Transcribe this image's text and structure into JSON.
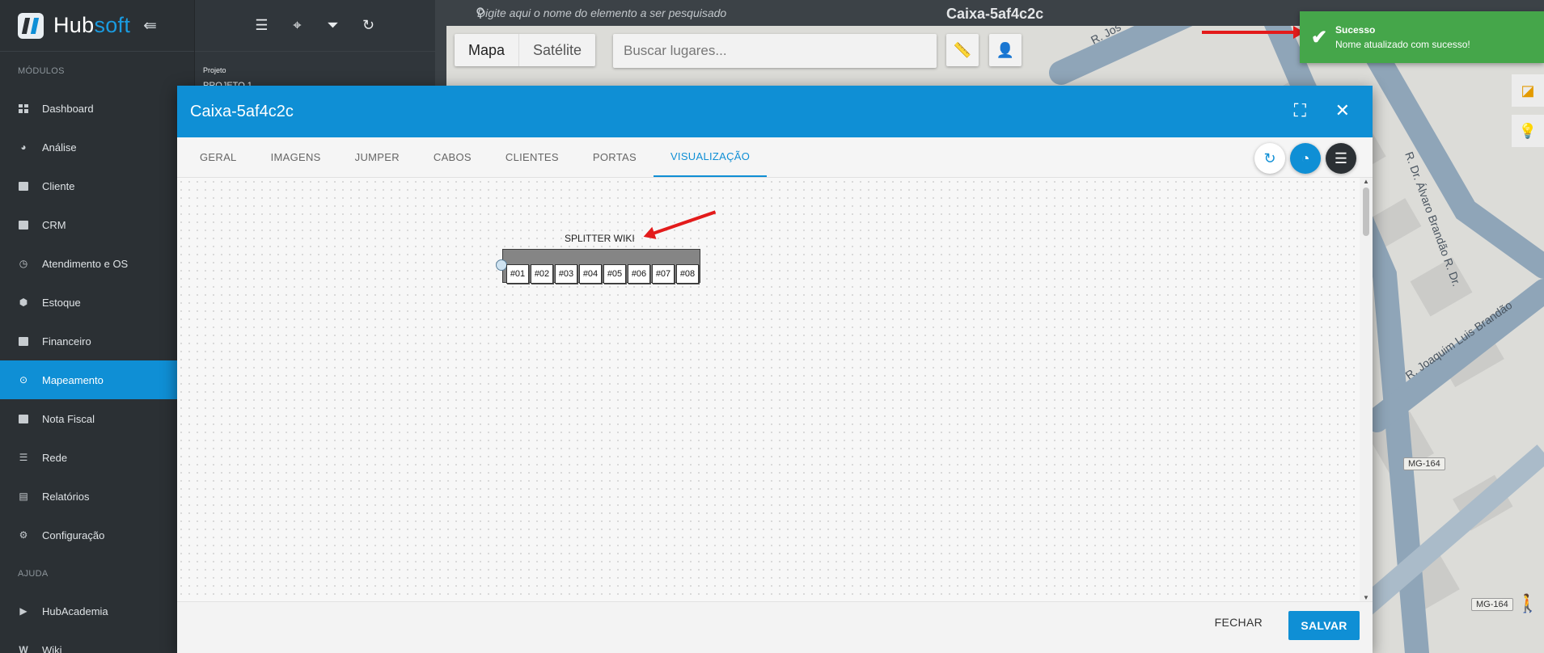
{
  "brand": {
    "name_part1": "Hub",
    "name_part2": "soft"
  },
  "sidebar": {
    "section_modules": "MÓDULOS",
    "items": [
      {
        "label": "Dashboard",
        "icon": "dashboard-icon"
      },
      {
        "label": "Análise",
        "icon": "pie-chart-icon"
      },
      {
        "label": "Cliente",
        "icon": "contact-card-icon",
        "has_submenu": true
      },
      {
        "label": "CRM",
        "icon": "crm-icon"
      },
      {
        "label": "Atendimento e OS",
        "icon": "calendar-clock-icon"
      },
      {
        "label": "Estoque",
        "icon": "box-icon"
      },
      {
        "label": "Financeiro",
        "icon": "money-icon"
      },
      {
        "label": "Mapeamento",
        "icon": "map-pin-icon",
        "active": true
      },
      {
        "label": "Nota Fiscal",
        "icon": "invoice-icon"
      },
      {
        "label": "Rede",
        "icon": "server-icon"
      },
      {
        "label": "Relatórios",
        "icon": "report-icon"
      },
      {
        "label": "Configuração",
        "icon": "gear-icon",
        "has_submenu": true
      }
    ],
    "section_help": "AJUDA",
    "help_items": [
      {
        "label": "HubAcademia",
        "icon": "play-icon"
      },
      {
        "label": "Wiki",
        "icon": "wiki-icon"
      }
    ]
  },
  "tool_panel": {
    "project_label": "Projeto",
    "project_value": "PROJETO 1"
  },
  "map": {
    "search_placeholder": "Digite aqui o nome do elemento a ser pesquisado",
    "title": "Caixa-5af4c2c",
    "map_type_options": [
      "Mapa",
      "Satélite"
    ],
    "selected_map_type": "Mapa",
    "places_placeholder": "Buscar lugares...",
    "road_tag_1": "MG-164",
    "road_tag_2": "MG-164"
  },
  "toast": {
    "title": "Sucesso",
    "message": "Nome atualizado com sucesso!",
    "color": "#45a64a"
  },
  "modal": {
    "title": "Caixa-5af4c2c",
    "tabs": [
      "GERAL",
      "IMAGENS",
      "JUMPER",
      "CABOS",
      "CLIENTES",
      "PORTAS",
      "VISUALIZAÇÃO"
    ],
    "active_tab": "VISUALIZAÇÃO",
    "splitter": {
      "label": "SPLITTER WIKI",
      "ports": [
        "#01",
        "#02",
        "#03",
        "#04",
        "#05",
        "#06",
        "#07",
        "#08"
      ]
    },
    "footer": {
      "close_label": "FECHAR",
      "save_label": "SALVAR"
    }
  },
  "colors": {
    "accent": "#0f8fd5",
    "sidebar_bg": "#2b3034",
    "annotation_arrow": "#e31b1b"
  }
}
